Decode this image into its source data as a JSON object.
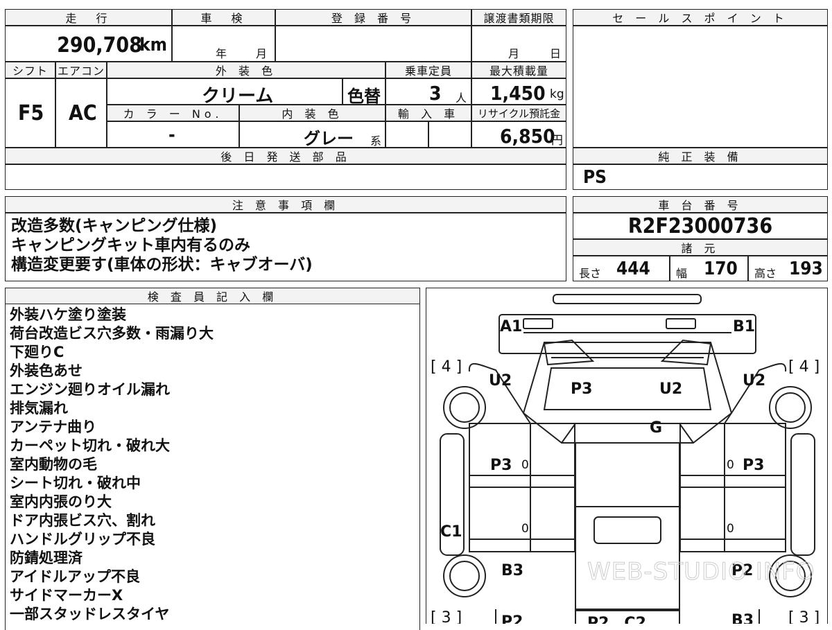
{
  "top": {
    "mileage_header": "走　行",
    "mileage_value": "290,708",
    "mileage_unit": "km",
    "inspection_header": "車　検",
    "inspection_year": "年",
    "inspection_month": "月",
    "reg_header": "登 録 番 号",
    "transfer_header": "譲渡書類期限",
    "transfer_month": "月",
    "transfer_day": "日",
    "sales_header": "セ ー ル ス ポ イ ン ト"
  },
  "specs": {
    "shift_header": "シフト",
    "shift_value": "F5",
    "ac_header": "エアコン",
    "ac_value": "AC",
    "exterior_header": "外 装 色",
    "exterior_value": "クリーム",
    "color_change": "色替",
    "capacity_header": "乗車定員",
    "capacity_value": "3",
    "capacity_unit": "人",
    "maxload_header": "最大積載量",
    "maxload_value": "1,450",
    "maxload_unit": "kg",
    "colorno_header": "カ ラ ー No.",
    "colorno_value": "-",
    "interior_header": "内 装 色",
    "interior_value": "グレー",
    "interior_suffix": "系",
    "import_header": "輸 入 車",
    "recycle_header": "リサイクル預託金",
    "recycle_value": "6,850",
    "recycle_unit": "円"
  },
  "later_parts": {
    "header": "後 日 発 送 部 品"
  },
  "equipment": {
    "header": "純 正 装 備",
    "value": "PS"
  },
  "notes": {
    "header": "注 意 事 項 欄",
    "lines": [
      "改造多数(キャンピング仕様)",
      "キャンピングキット車内有るのみ",
      "構造変更要す(車体の形状：キャブオーバ)"
    ]
  },
  "chassis": {
    "header": "車 台 番 号",
    "value": "R2F23000736",
    "dims_header": "諸 元",
    "length_label": "長さ",
    "length_value": "444",
    "width_label": "幅",
    "width_value": "170",
    "height_label": "高さ",
    "height_value": "193"
  },
  "inspector": {
    "header": "検 査 員 記 入 欄",
    "lines": [
      "外装ハケ塗り塗装",
      "荷台改造ビス穴多数・雨漏り大",
      "下廻りC",
      "外装色あせ",
      "エンジン廻りオイル漏れ",
      "排気漏れ",
      "アンテナ曲り",
      "カーペット切れ・破れ大",
      "室内動物の毛",
      "シート切れ・破れ中",
      "室内内張のり大",
      "ドア内張ビス穴、割れ",
      "ハンドルグリップ不良",
      "防錆処理済",
      "アイドルアップ不良",
      "サイドマーカーX",
      "一部スタッドレスタイヤ"
    ]
  },
  "diagram": {
    "a1": "A1",
    "b1": "B1",
    "tire_fl": "[ 4 ]",
    "tire_fr": "[ 4 ]",
    "u2_left": "U2",
    "u2_right": "U2",
    "u2_center": "U2",
    "p3_center": "P3",
    "g": "G",
    "p3_left": "P3",
    "p3_right": "P3",
    "zero_l1": "0",
    "zero_r1": "0",
    "zero_l2": "0",
    "zero_r2": "0",
    "c1": "C1",
    "b3_left": "B3",
    "p2_right": "P2",
    "tire_rl": "[ 3 ]",
    "tire_rr": "[ 3 ]",
    "p2_bottom_left": "P2",
    "b3_bottom_right": "B3",
    "bottom_center": "P2　C2",
    "watermark": "WEB-STUDIO INFO"
  }
}
